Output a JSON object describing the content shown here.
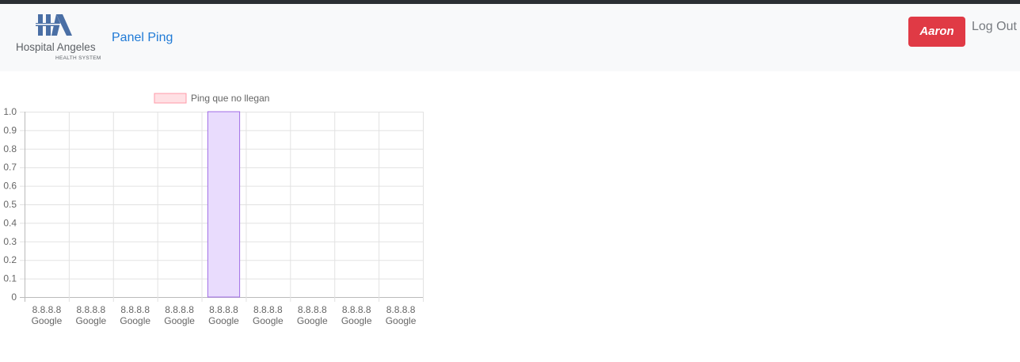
{
  "navbar": {
    "logo": {
      "name": "Hospital Angeles",
      "subtitle": "HEALTH SYSTEM"
    },
    "panel_link": "Panel Ping",
    "user_button": "Aaron",
    "logout": "Log Out"
  },
  "colors": {
    "accent_link": "#1f7ad6",
    "user_button": "#e03a45",
    "legend_box": "#ff9aa8",
    "highlight_bar": "#a06ce6"
  },
  "chart_data": {
    "type": "bar",
    "legend": [
      "Ping que no llegan"
    ],
    "legend_position": "top",
    "categories": [
      [
        "8.8.8.8",
        "Google"
      ],
      [
        "8.8.8.8",
        "Google"
      ],
      [
        "8.8.8.8",
        "Google"
      ],
      [
        "8.8.8.8",
        "Google"
      ],
      [
        "8.8.8.8",
        "Google"
      ],
      [
        "8.8.8.8",
        "Google"
      ],
      [
        "8.8.8.8",
        "Google"
      ],
      [
        "8.8.8.8",
        "Google"
      ],
      [
        "8.8.8.8",
        "Google"
      ]
    ],
    "series": [
      {
        "name": "Ping que no llegan",
        "values": [
          0,
          0,
          0,
          0,
          1,
          0,
          0,
          0,
          0
        ]
      }
    ],
    "ylim": [
      0,
      1
    ],
    "yticks": [
      "0",
      "0.1",
      "0.2",
      "0.3",
      "0.4",
      "0.5",
      "0.6",
      "0.7",
      "0.8",
      "0.9",
      "1.0"
    ],
    "grid": true
  }
}
